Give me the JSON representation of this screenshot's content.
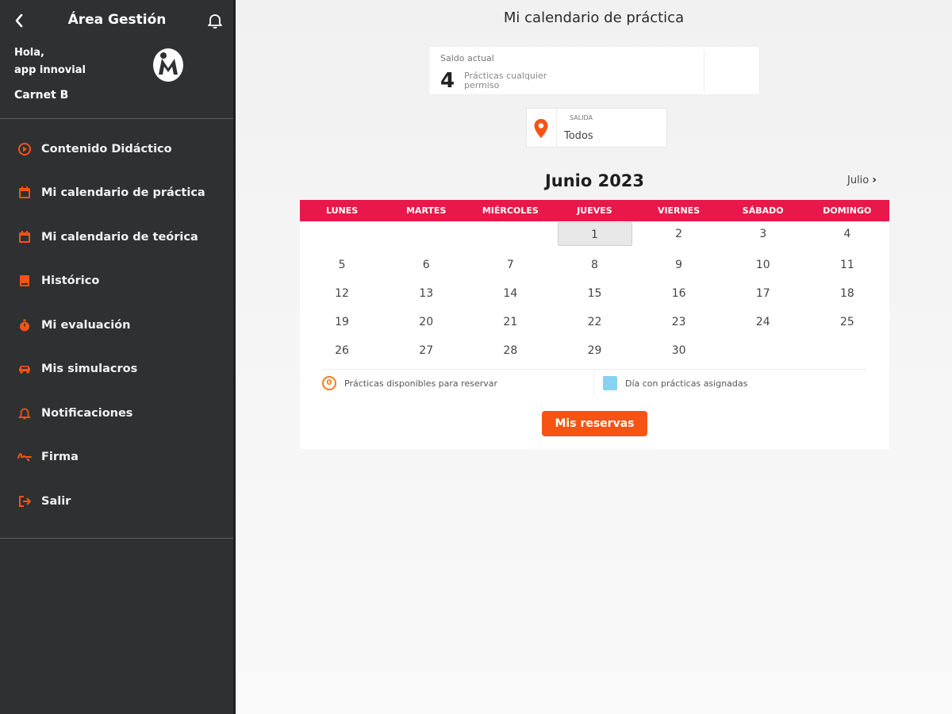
{
  "sidebar": {
    "title": "Área Gestión",
    "greeting": "Hola,",
    "username": "app innovial",
    "license": "Carnet B",
    "items": [
      {
        "label": "Contenido Didáctico",
        "icon": "play-circle-icon"
      },
      {
        "label": "Mi calendario de práctica",
        "icon": "calendar-icon"
      },
      {
        "label": "Mi calendario de teórica",
        "icon": "calendar-icon"
      },
      {
        "label": "Histórico",
        "icon": "book-icon"
      },
      {
        "label": "Mi evaluación",
        "icon": "stopwatch-icon"
      },
      {
        "label": "Mis simulacros",
        "icon": "car-icon"
      },
      {
        "label": "Notificaciones",
        "icon": "bell-icon"
      },
      {
        "label": "Firma",
        "icon": "signature-icon"
      },
      {
        "label": "Salir",
        "icon": "logout-icon"
      }
    ]
  },
  "main": {
    "title": "Mi calendario de práctica",
    "saldo": {
      "label": "Saldo actual",
      "value": "4",
      "description": "Prácticas cualquier permiso"
    },
    "salida": {
      "label": "SALIDA",
      "value": "Todos"
    },
    "calendar": {
      "month": "Junio 2023",
      "next_month": "Julio",
      "weekdays": [
        "LUNES",
        "MARTES",
        "MIÉRCOLES",
        "JUEVES",
        "VIERNES",
        "SÁBADO",
        "DOMINGO"
      ],
      "first_weekday_index": 3,
      "days_in_month": 30,
      "today": 1
    },
    "legend": {
      "available_badge": "0",
      "available": "Prácticas disponibles para reservar",
      "assigned": "Día con prácticas asignadas"
    },
    "reserve_button": "Mis reservas"
  },
  "colors": {
    "sidebar_bg": "#2e3032",
    "accent_orange": "#f65314",
    "weekday_bar": "#e8184a",
    "assigned_blue": "#87d2f0"
  }
}
